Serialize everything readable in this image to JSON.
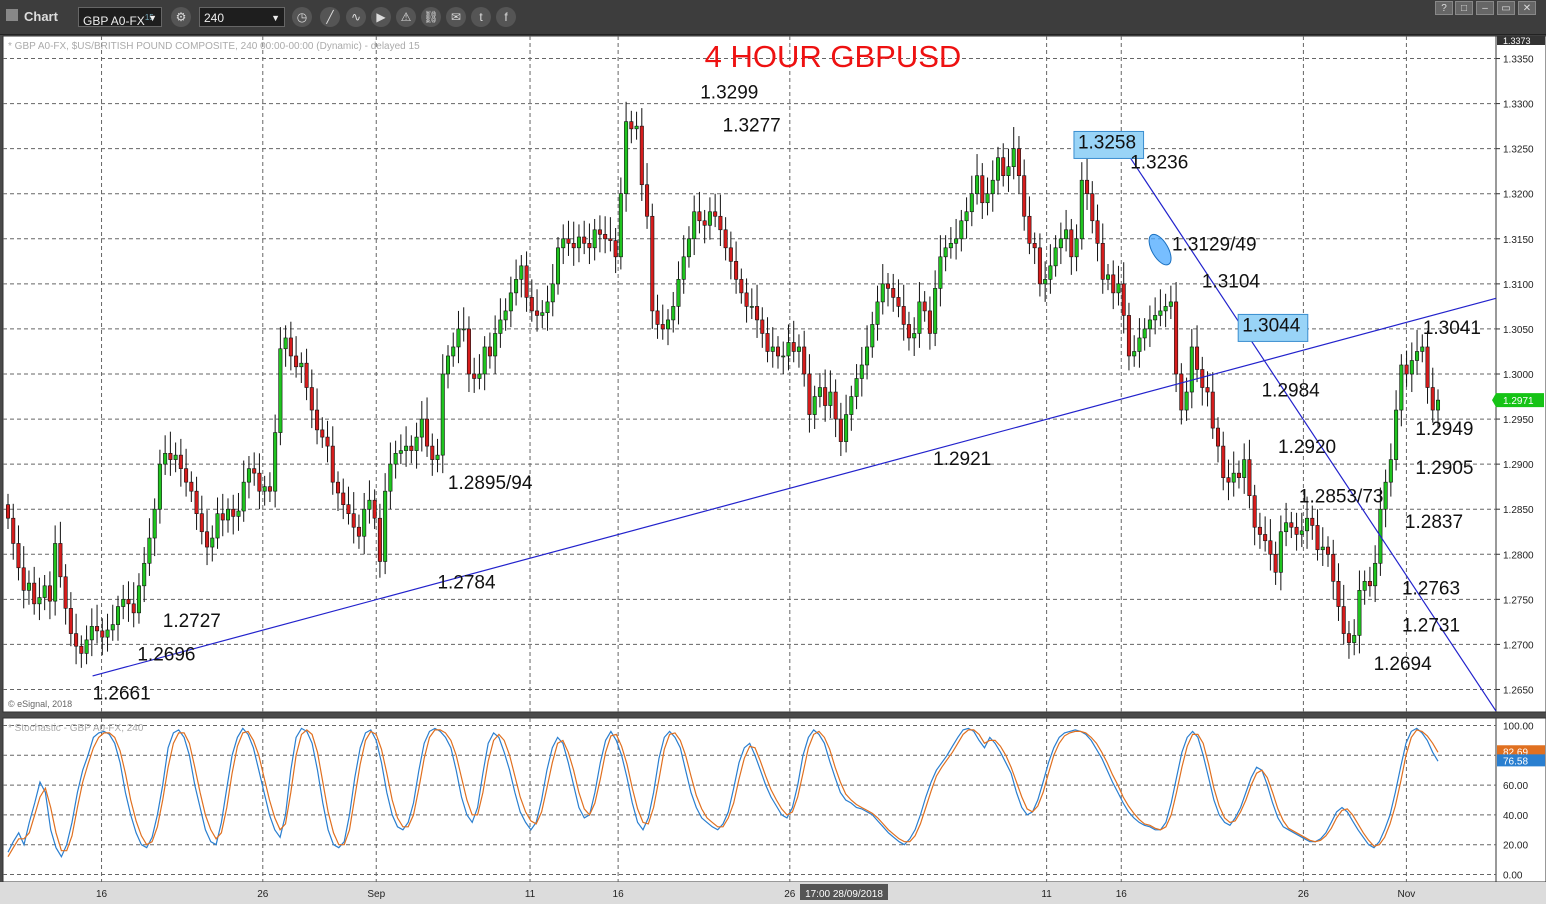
{
  "toolbar": {
    "app_label": "Chart",
    "symbol": "GBP A0-FX",
    "symbol_sup": "15",
    "interval": "240",
    "icons": [
      "gear-icon",
      "clock-icon",
      "line-tool-icon",
      "curve-icon",
      "play-icon",
      "alert-icon",
      "link-icon",
      "comment-icon",
      "twitter-icon",
      "facebook-icon"
    ],
    "window_buttons": [
      "?",
      "□",
      "–",
      "▭",
      "✕"
    ]
  },
  "chart_data": [
    {
      "type": "candlestick",
      "title": "4 HOUR GBPUSD",
      "subtitle": "* GBP A0-FX, $US/BRITISH POUND COMPOSITE, 240 00:00-00:00 (Dynamic) - delayed 15",
      "copyright": "© eSignal, 2018",
      "ylim": [
        1.2625,
        1.3375
      ],
      "y_ticks": [
        "1.3350",
        "1.3300",
        "1.3250",
        "1.3200",
        "1.3150",
        "1.3100",
        "1.3050",
        "1.3000",
        "1.2950",
        "1.2900",
        "1.2850",
        "1.2800",
        "1.2750",
        "1.2700",
        "1.2650"
      ],
      "y_top_tag": "1.3373",
      "last_price_tag": "1.2971",
      "x_ticks": [
        "16",
        "26",
        "Sep",
        "11",
        "16",
        "26",
        "11",
        "16",
        "26",
        "Nov"
      ],
      "cursor_label": "17:00 28/09/2018",
      "grid": true,
      "key_levels": [
        1.2661,
        1.2696,
        1.2727,
        1.2784,
        1.2895,
        1.3299,
        1.3277,
        1.2921,
        1.3258,
        1.3236,
        1.3129,
        1.3104,
        1.3044,
        1.2984,
        1.292,
        1.2853,
        1.2694,
        1.2731,
        1.2763,
        1.2837,
        1.2905,
        1.2949,
        1.3041
      ],
      "annotations": [
        {
          "text": "1.2661",
          "x_frac": 0.06,
          "y": 1.2661,
          "pos": "below"
        },
        {
          "text": "1.2696",
          "x_frac": 0.09,
          "y": 1.269,
          "pos": "right"
        },
        {
          "text": "1.2727",
          "x_frac": 0.107,
          "y": 1.2727,
          "pos": "right"
        },
        {
          "text": "1.2784",
          "x_frac": 0.291,
          "y": 1.2784,
          "pos": "below"
        },
        {
          "text": "1.2895/94",
          "x_frac": 0.298,
          "y": 1.288,
          "pos": "right"
        },
        {
          "text": "1.3299",
          "x_frac": 0.467,
          "y": 1.3299,
          "pos": "above"
        },
        {
          "text": "1.3277",
          "x_frac": 0.482,
          "y": 1.3277,
          "pos": "right"
        },
        {
          "text": "1.2921",
          "x_frac": 0.623,
          "y": 1.2921,
          "pos": "below"
        },
        {
          "text": "1.3258",
          "x_frac": 0.72,
          "y": 1.3258,
          "pos": "boxed"
        },
        {
          "text": "1.3236",
          "x_frac": 0.755,
          "y": 1.3236,
          "pos": "right"
        },
        {
          "text": "1.3129/49",
          "x_frac": 0.783,
          "y": 1.3145,
          "pos": "right"
        },
        {
          "text": "1.3104",
          "x_frac": 0.803,
          "y": 1.3104,
          "pos": "right"
        },
        {
          "text": "1.3044",
          "x_frac": 0.83,
          "y": 1.3055,
          "pos": "boxed"
        },
        {
          "text": "1.2984",
          "x_frac": 0.843,
          "y": 1.2983,
          "pos": "right"
        },
        {
          "text": "1.2920",
          "x_frac": 0.854,
          "y": 1.292,
          "pos": "right"
        },
        {
          "text": "1.2853/73",
          "x_frac": 0.868,
          "y": 1.2865,
          "pos": "right"
        },
        {
          "text": "1.2694",
          "x_frac": 0.918,
          "y": 1.2694,
          "pos": "below"
        },
        {
          "text": "1.2731",
          "x_frac": 0.937,
          "y": 1.2722,
          "pos": "right"
        },
        {
          "text": "1.2763",
          "x_frac": 0.937,
          "y": 1.2763,
          "pos": "right"
        },
        {
          "text": "1.2837",
          "x_frac": 0.939,
          "y": 1.2837,
          "pos": "right"
        },
        {
          "text": "1.2905",
          "x_frac": 0.946,
          "y": 1.2897,
          "pos": "right"
        },
        {
          "text": "1.2949",
          "x_frac": 0.946,
          "y": 1.294,
          "pos": "right"
        },
        {
          "text": "1.3041",
          "x_frac": 0.951,
          "y": 1.3052,
          "pos": "right"
        }
      ],
      "trendlines": [
        {
          "from": [
            0.06,
            1.2665
          ],
          "to": [
            1.0,
            1.3084
          ],
          "color": "#2222cc"
        },
        {
          "from": [
            0.755,
            1.324
          ],
          "to": [
            1.0,
            1.2626
          ],
          "color": "#2222cc"
        }
      ],
      "series": [
        {
          "name": "GBP A0-FX",
          "values": [
            1.284,
            1.2812,
            1.2785,
            1.276,
            1.2768,
            1.2745,
            1.2752,
            1.2765,
            1.2748,
            1.2812,
            1.2775,
            1.274,
            1.2712,
            1.2698,
            1.269,
            1.2705,
            1.272,
            1.2715,
            1.2708,
            1.2716,
            1.2722,
            1.2742,
            1.275,
            1.2745,
            1.2735,
            1.2765,
            1.279,
            1.2818,
            1.285,
            1.29,
            1.2912,
            1.2905,
            1.291,
            1.2895,
            1.288,
            1.287,
            1.2845,
            1.2825,
            1.2808,
            1.2818,
            1.2845,
            1.2838,
            1.285,
            1.2842,
            1.2848,
            1.288,
            1.2895,
            1.289,
            1.287,
            1.2875,
            1.287,
            1.2935,
            1.3028,
            1.304,
            1.302,
            1.3008,
            1.3012,
            1.2985,
            1.296,
            1.2938,
            1.293,
            1.292,
            1.288,
            1.2868,
            1.2855,
            1.2845,
            1.283,
            1.282,
            1.285,
            1.286,
            1.284,
            1.2792,
            1.287,
            1.29,
            1.2912,
            1.2915,
            1.292,
            1.2915,
            1.293,
            1.295,
            1.292,
            1.2905,
            1.291,
            1.3,
            1.302,
            1.303,
            1.305,
            1.305,
            1.3,
            1.2995,
            1.3,
            1.303,
            1.302,
            1.3045,
            1.306,
            1.307,
            1.309,
            1.3105,
            1.312,
            1.3085,
            1.307,
            1.3065,
            1.3068,
            1.308,
            1.31,
            1.314,
            1.315,
            1.3145,
            1.314,
            1.3152,
            1.3145,
            1.314,
            1.316,
            1.3155,
            1.315,
            1.3148,
            1.313,
            1.32,
            1.328,
            1.3272,
            1.3275,
            1.321,
            1.3175,
            1.307,
            1.3055,
            1.305,
            1.306,
            1.3075,
            1.3105,
            1.313,
            1.315,
            1.318,
            1.317,
            1.3165,
            1.318,
            1.3175,
            1.316,
            1.314,
            1.3125,
            1.3105,
            1.309,
            1.3075,
            1.3075,
            1.306,
            1.3045,
            1.3025,
            1.303,
            1.302,
            1.302,
            1.3035,
            1.3025,
            1.303,
            1.3,
            1.2955,
            1.2975,
            1.2985,
            1.2965,
            1.298,
            1.295,
            1.2925,
            1.2955,
            1.2975,
            1.2995,
            1.301,
            1.303,
            1.3055,
            1.308,
            1.31,
            1.3095,
            1.3085,
            1.3075,
            1.3055,
            1.304,
            1.3045,
            1.308,
            1.307,
            1.3045,
            1.3095,
            1.313,
            1.314,
            1.3145,
            1.315,
            1.317,
            1.318,
            1.32,
            1.322,
            1.319,
            1.32,
            1.3215,
            1.324,
            1.322,
            1.323,
            1.325,
            1.322,
            1.3175,
            1.3145,
            1.314,
            1.31,
            1.3105,
            1.312,
            1.314,
            1.315,
            1.316,
            1.313,
            1.315,
            1.3215,
            1.32,
            1.317,
            1.3145,
            1.3105,
            1.311,
            1.309,
            1.31,
            1.3065,
            1.302,
            1.3025,
            1.304,
            1.305,
            1.306,
            1.3065,
            1.307,
            1.3075,
            1.308,
            1.3,
            1.296,
            1.298,
            1.303,
            1.3005,
            1.2985,
            1.298,
            1.294,
            1.292,
            1.2885,
            1.288,
            1.289,
            1.2885,
            1.2905,
            1.2865,
            1.283,
            1.2822,
            1.2815,
            1.28,
            1.278,
            1.2825,
            1.2835,
            1.283,
            1.2822,
            1.2826,
            1.284,
            1.2832,
            1.2805,
            1.2808,
            1.28,
            1.277,
            1.2742,
            1.2712,
            1.2702,
            1.271,
            1.276,
            1.277,
            1.2765,
            1.279,
            1.285,
            1.288,
            1.2905,
            1.296,
            1.301,
            1.3,
            1.3015,
            1.3025,
            1.303,
            1.2985,
            1.296,
            1.2971
          ]
        }
      ]
    },
    {
      "type": "line",
      "title": "* Stochastic - GBP A0-FX, 240",
      "ylim": [
        -5,
        105
      ],
      "y_ticks": [
        "100.00",
        "80.00",
        "60.00",
        "40.00",
        "20.00",
        "0.00"
      ],
      "tags": [
        {
          "value": "82.69",
          "color": "#e07020"
        },
        {
          "value": "76.58",
          "color": "#2a7fd0"
        }
      ],
      "series": [
        {
          "name": "%K",
          "color": "#2a7fd0",
          "values": [
            15,
            22,
            28,
            20,
            35,
            48,
            62,
            55,
            30,
            18,
            12,
            20,
            35,
            55,
            70,
            80,
            92,
            95,
            96,
            94,
            88,
            75,
            55,
            40,
            28,
            20,
            18,
            25,
            40,
            60,
            85,
            95,
            97,
            92,
            80,
            60,
            45,
            30,
            22,
            20,
            35,
            58,
            80,
            92,
            98,
            94,
            85,
            70,
            55,
            40,
            30,
            25,
            40,
            70,
            92,
            98,
            96,
            88,
            70,
            48,
            30,
            20,
            18,
            22,
            40,
            65,
            85,
            95,
            97,
            90,
            75,
            55,
            40,
            32,
            30,
            35,
            48,
            70,
            88,
            96,
            98,
            96,
            92,
            85,
            70,
            52,
            40,
            35,
            45,
            68,
            88,
            95,
            92,
            82,
            70,
            55,
            42,
            35,
            30,
            35,
            50,
            70,
            85,
            92,
            88,
            75,
            60,
            45,
            38,
            40,
            55,
            75,
            90,
            96,
            90,
            80,
            65,
            48,
            35,
            30,
            38,
            55,
            78,
            92,
            96,
            92,
            85,
            70,
            55,
            45,
            38,
            35,
            32,
            30,
            34,
            42,
            58,
            75,
            85,
            88,
            80,
            70,
            60,
            52,
            46,
            40,
            38,
            45,
            60,
            80,
            92,
            97,
            94,
            88,
            76,
            65,
            55,
            50,
            48,
            45,
            44,
            42,
            40,
            36,
            32,
            28,
            25,
            22,
            20,
            24,
            30,
            40,
            52,
            62,
            70,
            75,
            80,
            86,
            92,
            97,
            98,
            96,
            90,
            85,
            92,
            88,
            82,
            75,
            68,
            55,
            45,
            40,
            42,
            50,
            62,
            75,
            85,
            92,
            95,
            96,
            97,
            96,
            94,
            90,
            84,
            78,
            70,
            62,
            55,
            48,
            42,
            38,
            35,
            33,
            32,
            30,
            30,
            35,
            48,
            65,
            82,
            92,
            96,
            92,
            80,
            65,
            50,
            40,
            35,
            33,
            38,
            45,
            55,
            65,
            72,
            70,
            60,
            48,
            38,
            32,
            30,
            28,
            26,
            24,
            22,
            22,
            24,
            28,
            35,
            42,
            45,
            42,
            36,
            30,
            25,
            20,
            18,
            22,
            30,
            40,
            55,
            72,
            88,
            96,
            98,
            95,
            90,
            82,
            76
          ]
        },
        {
          "name": "%D",
          "color": "#e07020",
          "values": [
            12,
            18,
            24,
            24,
            28,
            40,
            52,
            58,
            45,
            28,
            16,
            16,
            26,
            45,
            62,
            74,
            85,
            92,
            95,
            95,
            92,
            83,
            68,
            50,
            36,
            26,
            20,
            22,
            32,
            50,
            72,
            88,
            95,
            95,
            88,
            72,
            55,
            40,
            30,
            24,
            28,
            45,
            68,
            86,
            95,
            96,
            90,
            80,
            65,
            50,
            38,
            30,
            34,
            55,
            80,
            94,
            97,
            94,
            82,
            62,
            42,
            28,
            20,
            20,
            30,
            52,
            74,
            90,
            96,
            94,
            84,
            68,
            50,
            38,
            32,
            32,
            40,
            58,
            78,
            92,
            97,
            97,
            95,
            90,
            80,
            65,
            50,
            40,
            40,
            55,
            76,
            90,
            94,
            90,
            80,
            66,
            52,
            42,
            36,
            34,
            42,
            58,
            75,
            88,
            90,
            82,
            70,
            55,
            44,
            40,
            48,
            64,
            82,
            93,
            94,
            86,
            74,
            58,
            44,
            35,
            34,
            45,
            64,
            84,
            94,
            95,
            90,
            80,
            66,
            53,
            44,
            38,
            35,
            32,
            32,
            38,
            48,
            64,
            78,
            86,
            85,
            76,
            66,
            57,
            50,
            44,
            40,
            42,
            52,
            68,
            85,
            94,
            96,
            92,
            84,
            72,
            62,
            54,
            50,
            47,
            45,
            43,
            41,
            38,
            34,
            30,
            27,
            24,
            22,
            22,
            26,
            34,
            45,
            56,
            66,
            72,
            77,
            82,
            88,
            94,
            97,
            97,
            94,
            88,
            90,
            90,
            86,
            80,
            72,
            62,
            52,
            44,
            42,
            46,
            55,
            68,
            80,
            88,
            93,
            95,
            96,
            96,
            95,
            92,
            88,
            82,
            75,
            67,
            60,
            52,
            46,
            41,
            37,
            34,
            33,
            31,
            30,
            32,
            40,
            55,
            72,
            86,
            94,
            94,
            88,
            74,
            58,
            46,
            38,
            35,
            36,
            42,
            50,
            60,
            68,
            70,
            65,
            55,
            44,
            36,
            31,
            29,
            27,
            25,
            23,
            22,
            23,
            26,
            31,
            38,
            43,
            44,
            40,
            34,
            28,
            23,
            19,
            20,
            25,
            34,
            46,
            62,
            80,
            92,
            97,
            96,
            93,
            88,
            82
          ]
        }
      ]
    }
  ]
}
